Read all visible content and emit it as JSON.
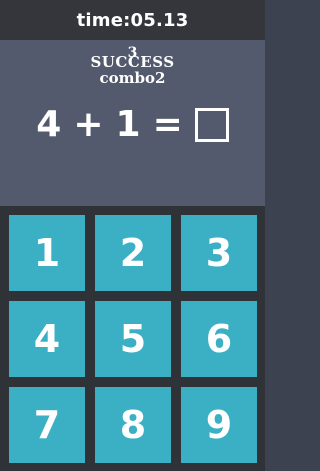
{
  "header": {
    "timer": "time:05.13"
  },
  "status": {
    "overlap_top": "3",
    "success": "SUCCESS",
    "combo": "combo2"
  },
  "equation": {
    "left": "4",
    "operator": "+",
    "right": "1",
    "equals": "=",
    "answer": ""
  },
  "keypad": {
    "keys": [
      "1",
      "2",
      "3",
      "4",
      "5",
      "6",
      "7",
      "8",
      "9"
    ]
  },
  "colors": {
    "top_bar": "#34363b",
    "question_panel": "#545a6d",
    "keypad_background": "#2f3236",
    "key": "#3bb0c4",
    "text": "#ffffff"
  }
}
